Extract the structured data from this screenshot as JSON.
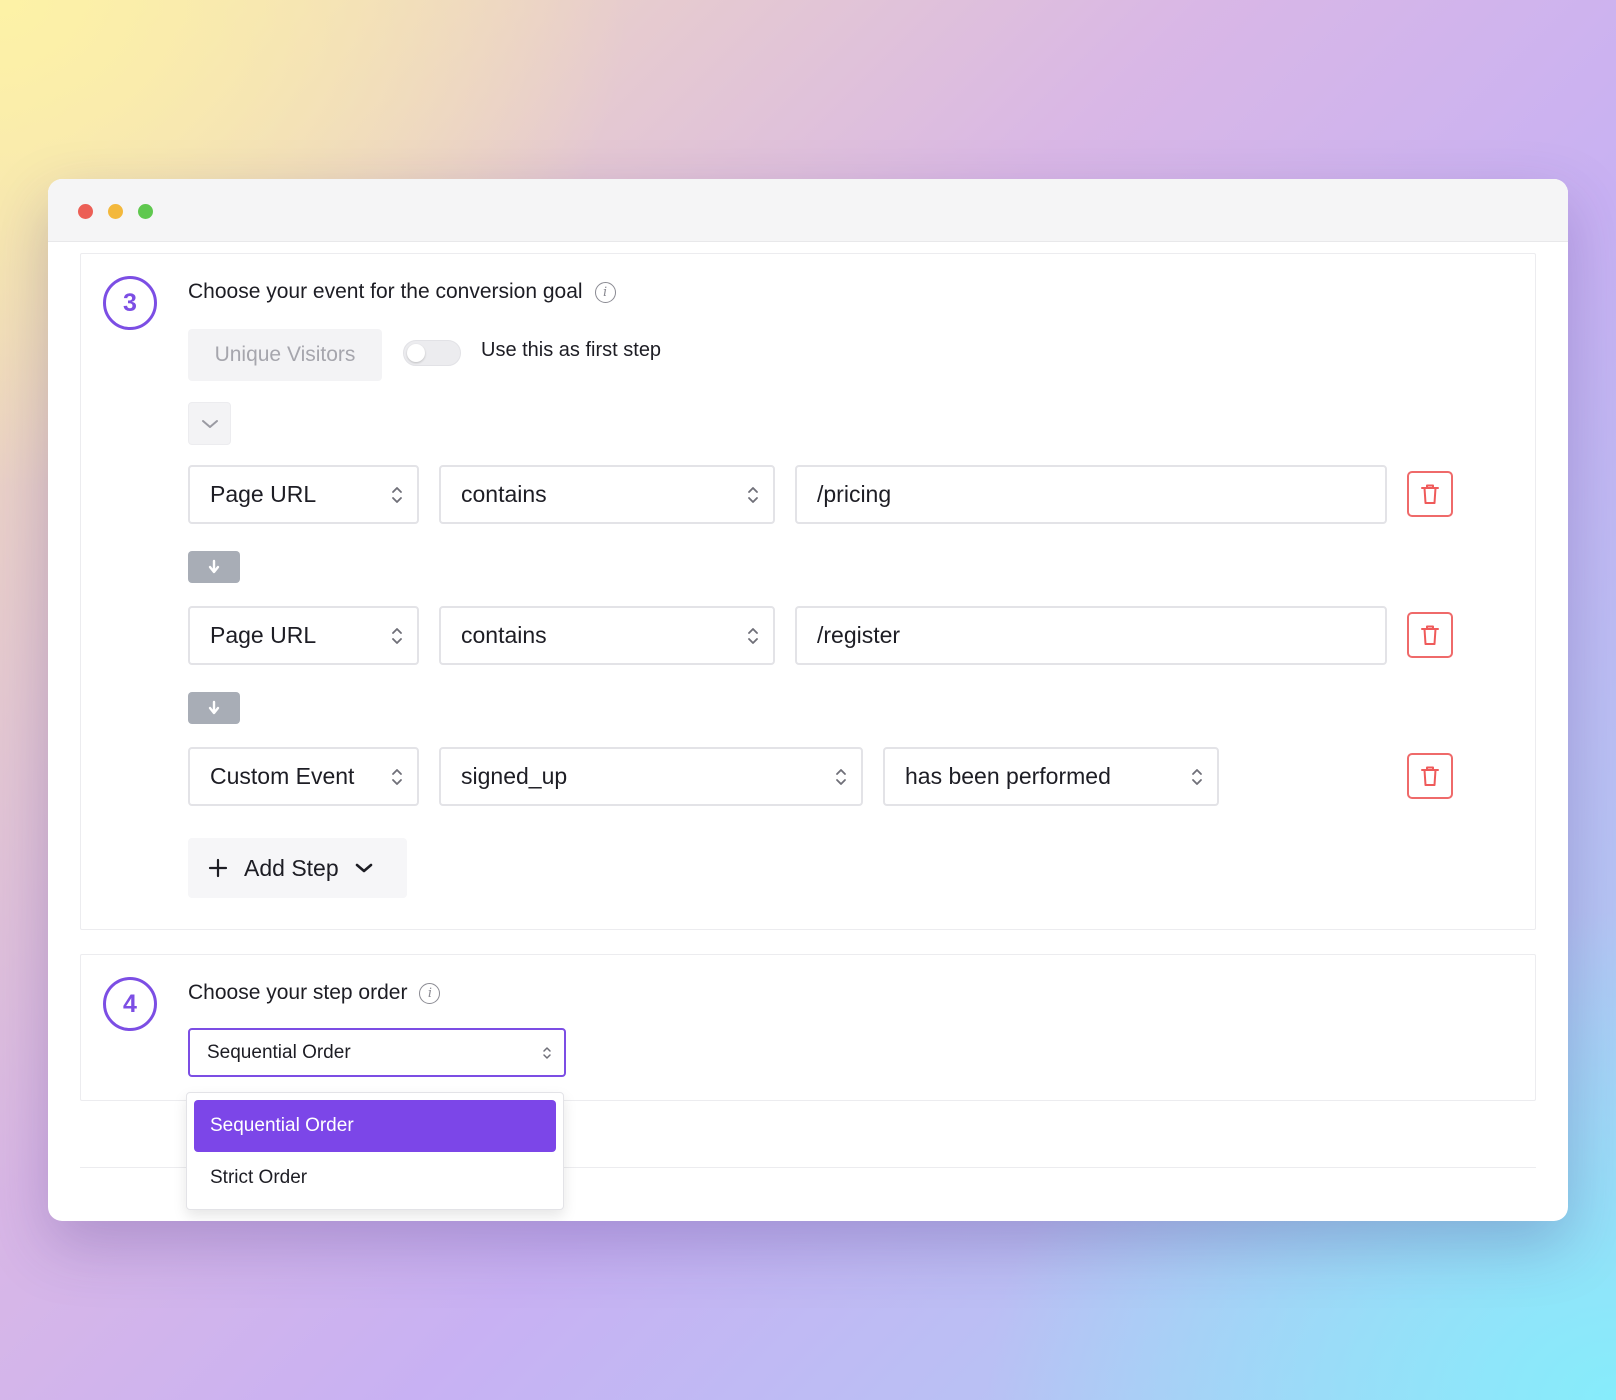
{
  "colors": {
    "accent": "#7c4ee4",
    "selected_bg": "#7c46e8",
    "danger": "#ef6a6a",
    "arrow_bg": "#a8adb6"
  },
  "step3": {
    "number": "3",
    "heading": "Choose your event for the conversion goal",
    "unique_visitors_label": "Unique Visitors",
    "toggle_label": "Use this as first step",
    "toggle_on": false,
    "rows": [
      {
        "field": "Page URL",
        "operator": "contains",
        "value": "/pricing"
      },
      {
        "field": "Page URL",
        "operator": "contains",
        "value": "/register"
      },
      {
        "field": "Custom Event",
        "event": "signed_up",
        "condition": "has been performed"
      }
    ],
    "add_step_label": "Add Step"
  },
  "step4": {
    "number": "4",
    "heading": "Choose your step order",
    "selected": "Sequential Order",
    "options": [
      "Sequential Order",
      "Strict Order"
    ]
  },
  "icons": {
    "info": "info-icon",
    "updown": "updown-chevron-icon",
    "trash": "trash-icon",
    "arrow_down": "arrow-down-icon",
    "plus": "plus-icon",
    "chevron_down": "chevron-down-icon"
  }
}
